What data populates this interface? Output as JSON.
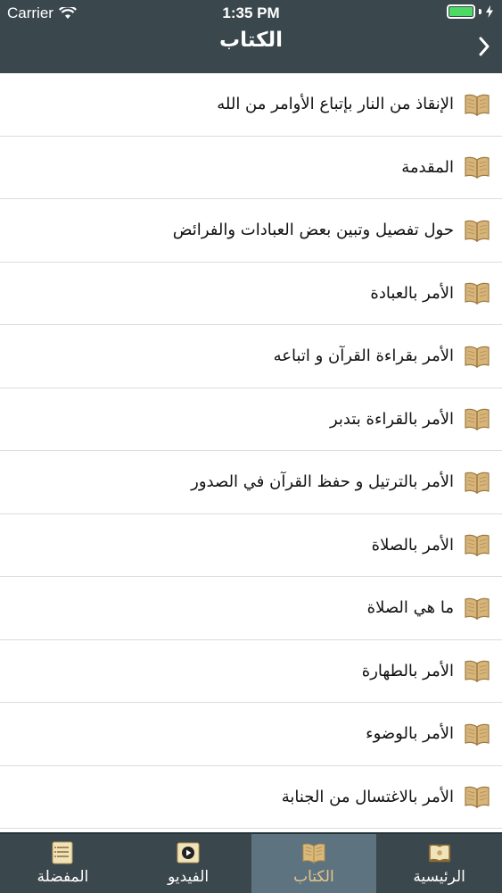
{
  "status_bar": {
    "carrier": "Carrier",
    "time": "1:35 PM"
  },
  "nav": {
    "title": "الكتاب",
    "back_icon": "chevron-right-icon"
  },
  "chapters": [
    {
      "label": "الإنقاذ من النار بإتباع الأوامر من الله"
    },
    {
      "label": "المقدمة"
    },
    {
      "label": "حول تفصيل وتبين بعض العبادات والفرائض"
    },
    {
      "label": "الأمر بالعبادة"
    },
    {
      "label": "الأمر بقراءة القرآن و اتباعه"
    },
    {
      "label": "الأمر بالقراءة بتدبر"
    },
    {
      "label": "الأمر بالترتيل و حفظ القرآن في الصدور"
    },
    {
      "label": "الأمر بالصلاة"
    },
    {
      "label": "ما هي الصلاة"
    },
    {
      "label": "الأمر بالطهارة"
    },
    {
      "label": "الأمر بالوضوء"
    },
    {
      "label": "الأمر بالاغتسال من الجنابة"
    }
  ],
  "tabs": [
    {
      "label": "المفضلة",
      "icon": "list-icon"
    },
    {
      "label": "الفيديو",
      "icon": "video-icon"
    },
    {
      "label": "الكتاب",
      "icon": "book-icon",
      "active": true
    },
    {
      "label": "الرئيسية",
      "icon": "home-book-icon"
    }
  ],
  "colors": {
    "bar_background": "#3a474d",
    "active_tab": "#5d7480",
    "book_icon": "#c9a46a",
    "battery": "#4cd964"
  }
}
